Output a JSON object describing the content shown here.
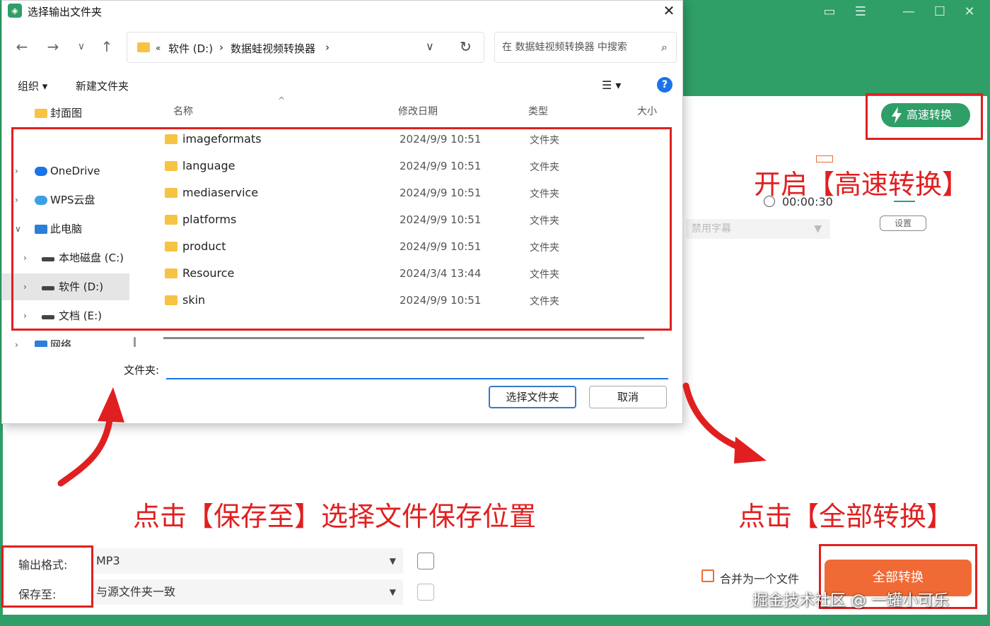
{
  "app": {
    "speed_button": "高速转换",
    "duration": "00:00:30",
    "settings_label": "设置",
    "subtitle_select": "禁用字幕",
    "window_controls": [
      "comment-icon",
      "menu-icon",
      "minimize-icon",
      "maximize-icon",
      "close-icon"
    ],
    "output_format_label": "输出格式:",
    "output_format_value": "MP3",
    "save_to_label": "保存至:",
    "save_to_value": "与源文件夹一致",
    "merge_label": "合并为一个文件",
    "convert_all_button": "全部转换",
    "watermark": "掘金技术社区 @ 一罐小可乐",
    "accent_color": "#2f9e67",
    "action_color": "#f06a35"
  },
  "dialog": {
    "title": "选择输出文件夹",
    "address": {
      "prefix": "«",
      "segments": [
        "软件 (D:)",
        "数据蛙视频转换器"
      ]
    },
    "search_placeholder": "在 数据蛙视频转换器 中搜索",
    "toolbar": {
      "organize": "组织 ▾",
      "new_folder": "新建文件夹"
    },
    "tree": [
      {
        "label": "封面图",
        "icon": "folder-icon"
      },
      {
        "label": "OneDrive",
        "icon": "cloud-icon"
      },
      {
        "label": "WPS云盘",
        "icon": "cloud-icon"
      },
      {
        "label": "此电脑",
        "icon": "computer-icon"
      },
      {
        "label": "本地磁盘 (C:)",
        "icon": "disk-icon"
      },
      {
        "label": "软件 (D:)",
        "icon": "disk-icon",
        "selected": true
      },
      {
        "label": "文档 (E:)",
        "icon": "disk-icon"
      },
      {
        "label": "网络",
        "icon": "network-icon"
      }
    ],
    "columns": {
      "name": "名称",
      "modified": "修改日期",
      "type": "类型",
      "size": "大小"
    },
    "files": [
      {
        "name": "imageformats",
        "date": "2024/9/9 10:51",
        "type": "文件夹"
      },
      {
        "name": "language",
        "date": "2024/9/9 10:51",
        "type": "文件夹"
      },
      {
        "name": "mediaservice",
        "date": "2024/9/9 10:51",
        "type": "文件夹"
      },
      {
        "name": "platforms",
        "date": "2024/9/9 10:51",
        "type": "文件夹"
      },
      {
        "name": "product",
        "date": "2024/9/9 10:51",
        "type": "文件夹"
      },
      {
        "name": "Resource",
        "date": "2024/3/4 13:44",
        "type": "文件夹"
      },
      {
        "name": "skin",
        "date": "2024/9/9 10:51",
        "type": "文件夹"
      }
    ],
    "folder_label": "文件夹:",
    "folder_value": "",
    "select_button": "选择文件夹",
    "cancel_button": "取消"
  },
  "annotations": {
    "speed_hint": "开启【高速转换】",
    "save_hint": "点击【保存至】选择文件保存位置",
    "convert_hint": "点击【全部转换】",
    "color": "#e02020"
  }
}
